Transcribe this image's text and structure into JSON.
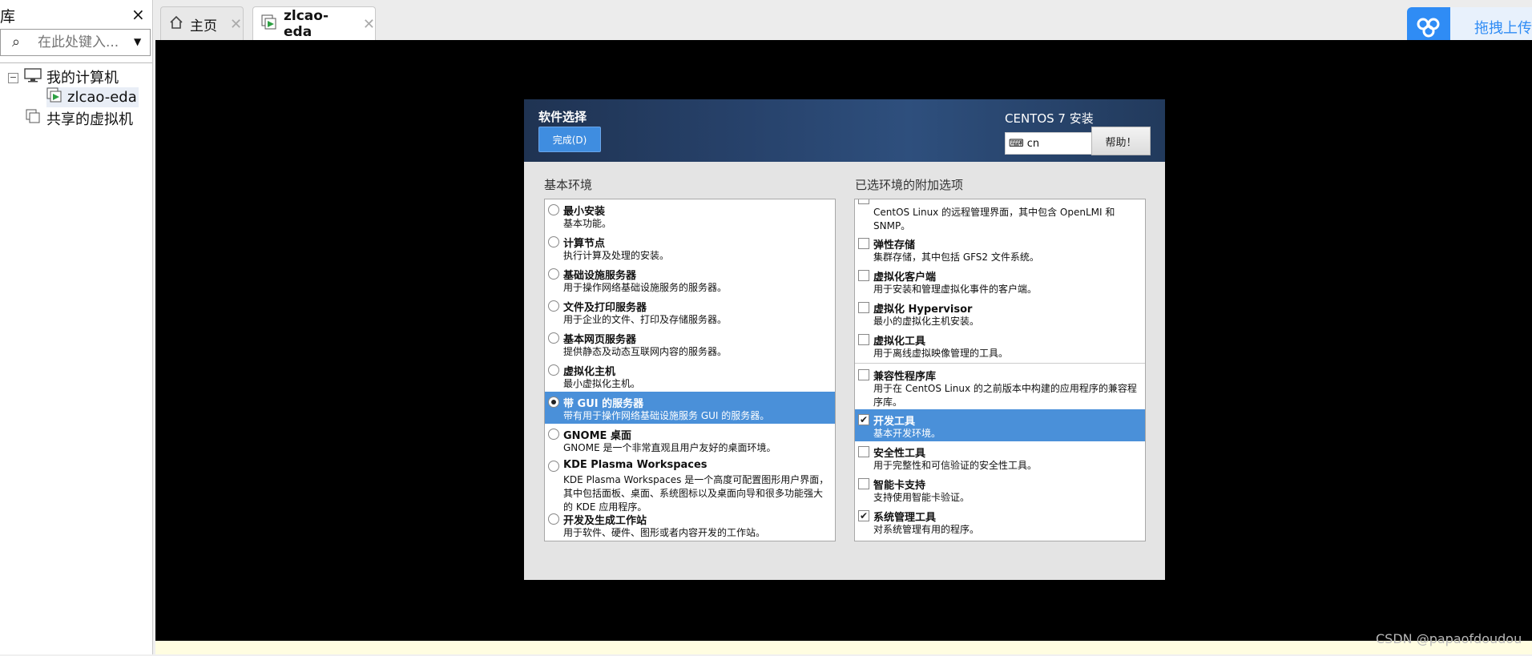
{
  "library": {
    "title": "库",
    "close_icon": "×",
    "search_placeholder": "在此处键入...",
    "tree": {
      "my_computer": "我的计算机",
      "vm_name": "zlcao-eda",
      "shared_vms": "共享的虚拟机"
    }
  },
  "tabs": [
    {
      "label": "主页",
      "icon": "home-icon"
    },
    {
      "label": "zlcao-eda",
      "icon": "vm-running-icon"
    }
  ],
  "upload": {
    "label": "拖拽上传"
  },
  "installer": {
    "title": "软件选择",
    "done_label": "完成(D)",
    "product": "CENTOS 7 安装",
    "keyboard_layout": "cn",
    "help_label": "帮助！",
    "base_env_title": "基本环境",
    "addons_title": "已选环境的附加选项",
    "environments": [
      {
        "name": "最小安装",
        "desc": "基本功能。",
        "selected": false
      },
      {
        "name": "计算节点",
        "desc": "执行计算及处理的安装。",
        "selected": false
      },
      {
        "name": "基础设施服务器",
        "desc": "用于操作网络基础设施服务的服务器。",
        "selected": false
      },
      {
        "name": "文件及打印服务器",
        "desc": "用于企业的文件、打印及存储服务器。",
        "selected": false
      },
      {
        "name": "基本网页服务器",
        "desc": "提供静态及动态互联网内容的服务器。",
        "selected": false
      },
      {
        "name": "虚拟化主机",
        "desc": "最小虚拟化主机。",
        "selected": false
      },
      {
        "name": "带 GUI 的服务器",
        "desc": "带有用于操作网络基础设施服务 GUI 的服务器。",
        "selected": true
      },
      {
        "name": "GNOME 桌面",
        "desc": "GNOME 是一个非常直观且用户友好的桌面环境。",
        "selected": false
      },
      {
        "name": "KDE Plasma Workspaces",
        "desc": "KDE Plasma Workspaces 是一个高度可配置图形用户界面，其中包括面板、桌面、系统图标以及桌面向导和很多功能强大的 KDE 应用程序。",
        "selected": false
      },
      {
        "name": "开发及生成工作站",
        "desc": "用于软件、硬件、图形或者内容开发的工作站。",
        "selected": false
      }
    ],
    "addons": [
      {
        "name": "",
        "desc": "CentOS Linux 的远程管理界面，其中包含 OpenLMI 和 SNMP。",
        "checked": false
      },
      {
        "name": "弹性存储",
        "desc": "集群存储，其中包括 GFS2 文件系统。",
        "checked": false
      },
      {
        "name": "虚拟化客户端",
        "desc": "用于安装和管理虚拟化事件的客户端。",
        "checked": false
      },
      {
        "name": "虚拟化 Hypervisor",
        "desc": "最小的虚拟化主机安装。",
        "checked": false
      },
      {
        "name": "虚拟化工具",
        "desc": "用于离线虚拟映像管理的工具。",
        "checked": false
      },
      {
        "name": "兼容性程序库",
        "desc": "用于在 CentOS Linux 的之前版本中构建的应用程序的兼容程序库。",
        "checked": false
      },
      {
        "name": "开发工具",
        "desc": "基本开发环境。",
        "checked": true,
        "highlight": true
      },
      {
        "name": "安全性工具",
        "desc": "用于完整性和可信验证的安全性工具。",
        "checked": false
      },
      {
        "name": "智能卡支持",
        "desc": "支持使用智能卡验证。",
        "checked": false
      },
      {
        "name": "系统管理工具",
        "desc": "对系统管理有用的程序。",
        "checked": true
      }
    ]
  },
  "watermark": "CSDN @papaofdoudou",
  "colors": {
    "selection": "#4a90d9",
    "done_button": "#3f8de0",
    "upload_brand": "#2f8cf5"
  }
}
